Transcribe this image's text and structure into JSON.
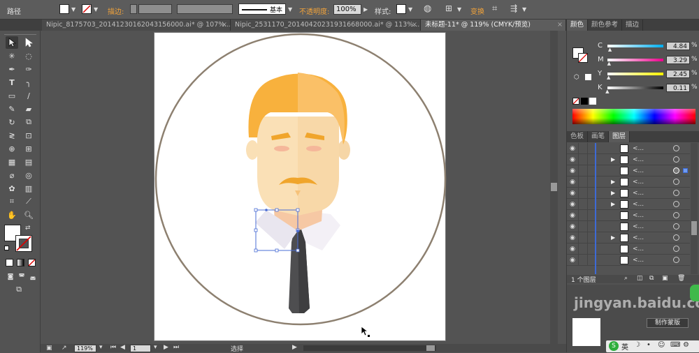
{
  "control_bar": {
    "selection_type": "路径",
    "stroke_label": "描边:",
    "stroke_style": "基本",
    "opacity_label": "不透明度:",
    "opacity_value": "100%",
    "style_label": "样式:",
    "transform_label": "变换"
  },
  "tabs": [
    {
      "label": "Nipic_8175703_20141230162043156000.ai* @ 107%..."
    },
    {
      "label": "Nipic_2531170_20140420231931668000.ai* @ 113%..."
    },
    {
      "label": "未标题-11* @ 119% (CMYK/预览)"
    }
  ],
  "status": {
    "zoom": "119%",
    "page": "1",
    "mode": "选择"
  },
  "color_panel": {
    "tabs": [
      "颜色",
      "颜色参考",
      "描边"
    ],
    "channels": [
      {
        "name": "C",
        "value": "4.84",
        "pct": 4.84,
        "color": "#00aeef"
      },
      {
        "name": "M",
        "value": "3.29",
        "pct": 3.29,
        "color": "#ec008c"
      },
      {
        "name": "Y",
        "value": "2.45",
        "pct": 2.45,
        "color": "#fff200"
      },
      {
        "name": "K",
        "value": "0.11",
        "pct": 0.11,
        "color": "#000000"
      }
    ]
  },
  "layers_panel": {
    "tabs": [
      "色板",
      "画笔",
      "图层"
    ],
    "rows": [
      {
        "name": "<...",
        "expand": false
      },
      {
        "name": "<...",
        "expand": true
      },
      {
        "name": "<...",
        "expand": false,
        "targeted": true
      },
      {
        "name": "<...",
        "expand": true
      },
      {
        "name": "<...",
        "expand": true
      },
      {
        "name": "<...",
        "expand": true
      },
      {
        "name": "<...",
        "expand": false
      },
      {
        "name": "<...",
        "expand": false
      },
      {
        "name": "<...",
        "expand": true
      },
      {
        "name": "<...",
        "expand": false
      },
      {
        "name": "<...",
        "expand": false
      }
    ],
    "footer": "1 个图层"
  },
  "watermark": {
    "text": "jingyan.baidu.com",
    "button": "制作蒙版"
  },
  "ime": {
    "label": "英"
  },
  "colors": {
    "hair": "#f8b13d",
    "hair_light": "#fac067",
    "skin": "#fae0b6",
    "neck": "#f6c8a4",
    "brow": "#f0a52c",
    "tie": "#4e4e50",
    "circle": "#8d8070"
  }
}
